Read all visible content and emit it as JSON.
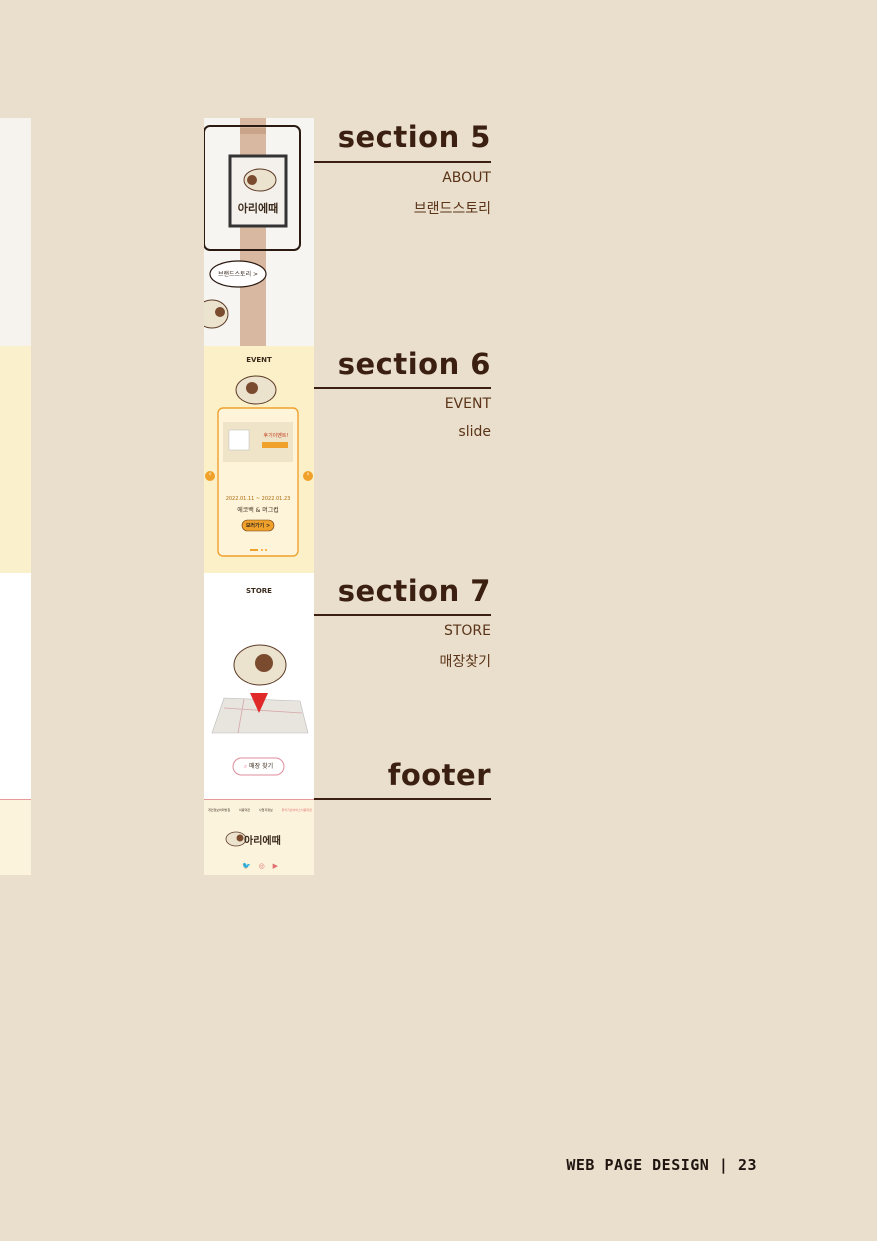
{
  "sections": [
    {
      "title": "section 5",
      "sub1": "ABOUT",
      "sub2": "브랜드스토리"
    },
    {
      "title": "section 6",
      "sub1": "EVENT",
      "sub2": "slide"
    },
    {
      "title": "section 7",
      "sub1": "STORE",
      "sub2": "매장찾기"
    },
    {
      "title": "footer"
    }
  ],
  "mock": {
    "about": {
      "sign_text": "아리에때",
      "bubble_text": "브랜드스토리 >"
    },
    "event": {
      "heading": "EVENT",
      "dates": "2022.01.11 ~ 2022.01.23",
      "name": "에코백 & 머그컵",
      "cta": "보러가기 >",
      "banner_text": "후기이벤트!"
    },
    "store": {
      "heading": "STORE",
      "button": "매장 찾기"
    },
    "footer": {
      "links": [
        "개인정보처리방침",
        "이용약관",
        "사업자정보",
        "위치기반서비스이용약관"
      ],
      "brand": "아리에때"
    }
  },
  "page_footer": {
    "label": "WEB PAGE DESIGN",
    "page": "23"
  },
  "colors": {
    "background": "#e9dfcc",
    "heading": "#3b1f10",
    "event_bg": "#fbf0c8",
    "accent_orange": "#f0a12c",
    "accent_pink": "#e59a9a"
  }
}
